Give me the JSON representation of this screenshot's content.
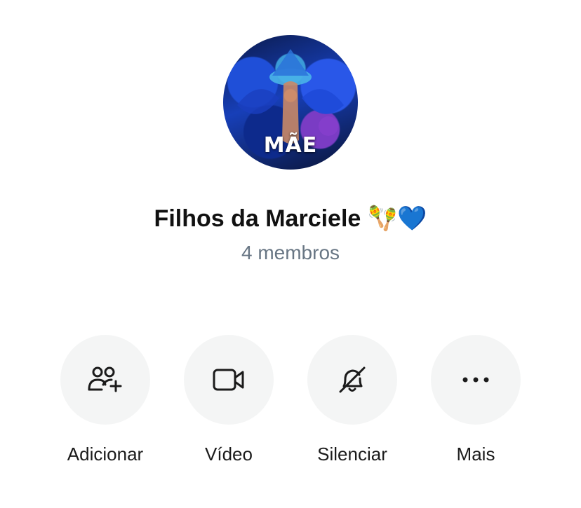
{
  "profile": {
    "avatar_label": "MÃE",
    "group_name": "Filhos da Marciele",
    "group_emoji": "🪇💙",
    "member_count": "4 membros"
  },
  "actions": [
    {
      "label": "Adicionar",
      "icon": "add-people-icon"
    },
    {
      "label": "Vídeo",
      "icon": "video-camera-icon"
    },
    {
      "label": "Silenciar",
      "icon": "bell-off-icon"
    },
    {
      "label": "Mais",
      "icon": "more-dots-icon"
    }
  ],
  "colors": {
    "background": "#ffffff",
    "text_primary": "#111111",
    "text_secondary": "#687684",
    "button_bg": "#f4f5f5"
  }
}
